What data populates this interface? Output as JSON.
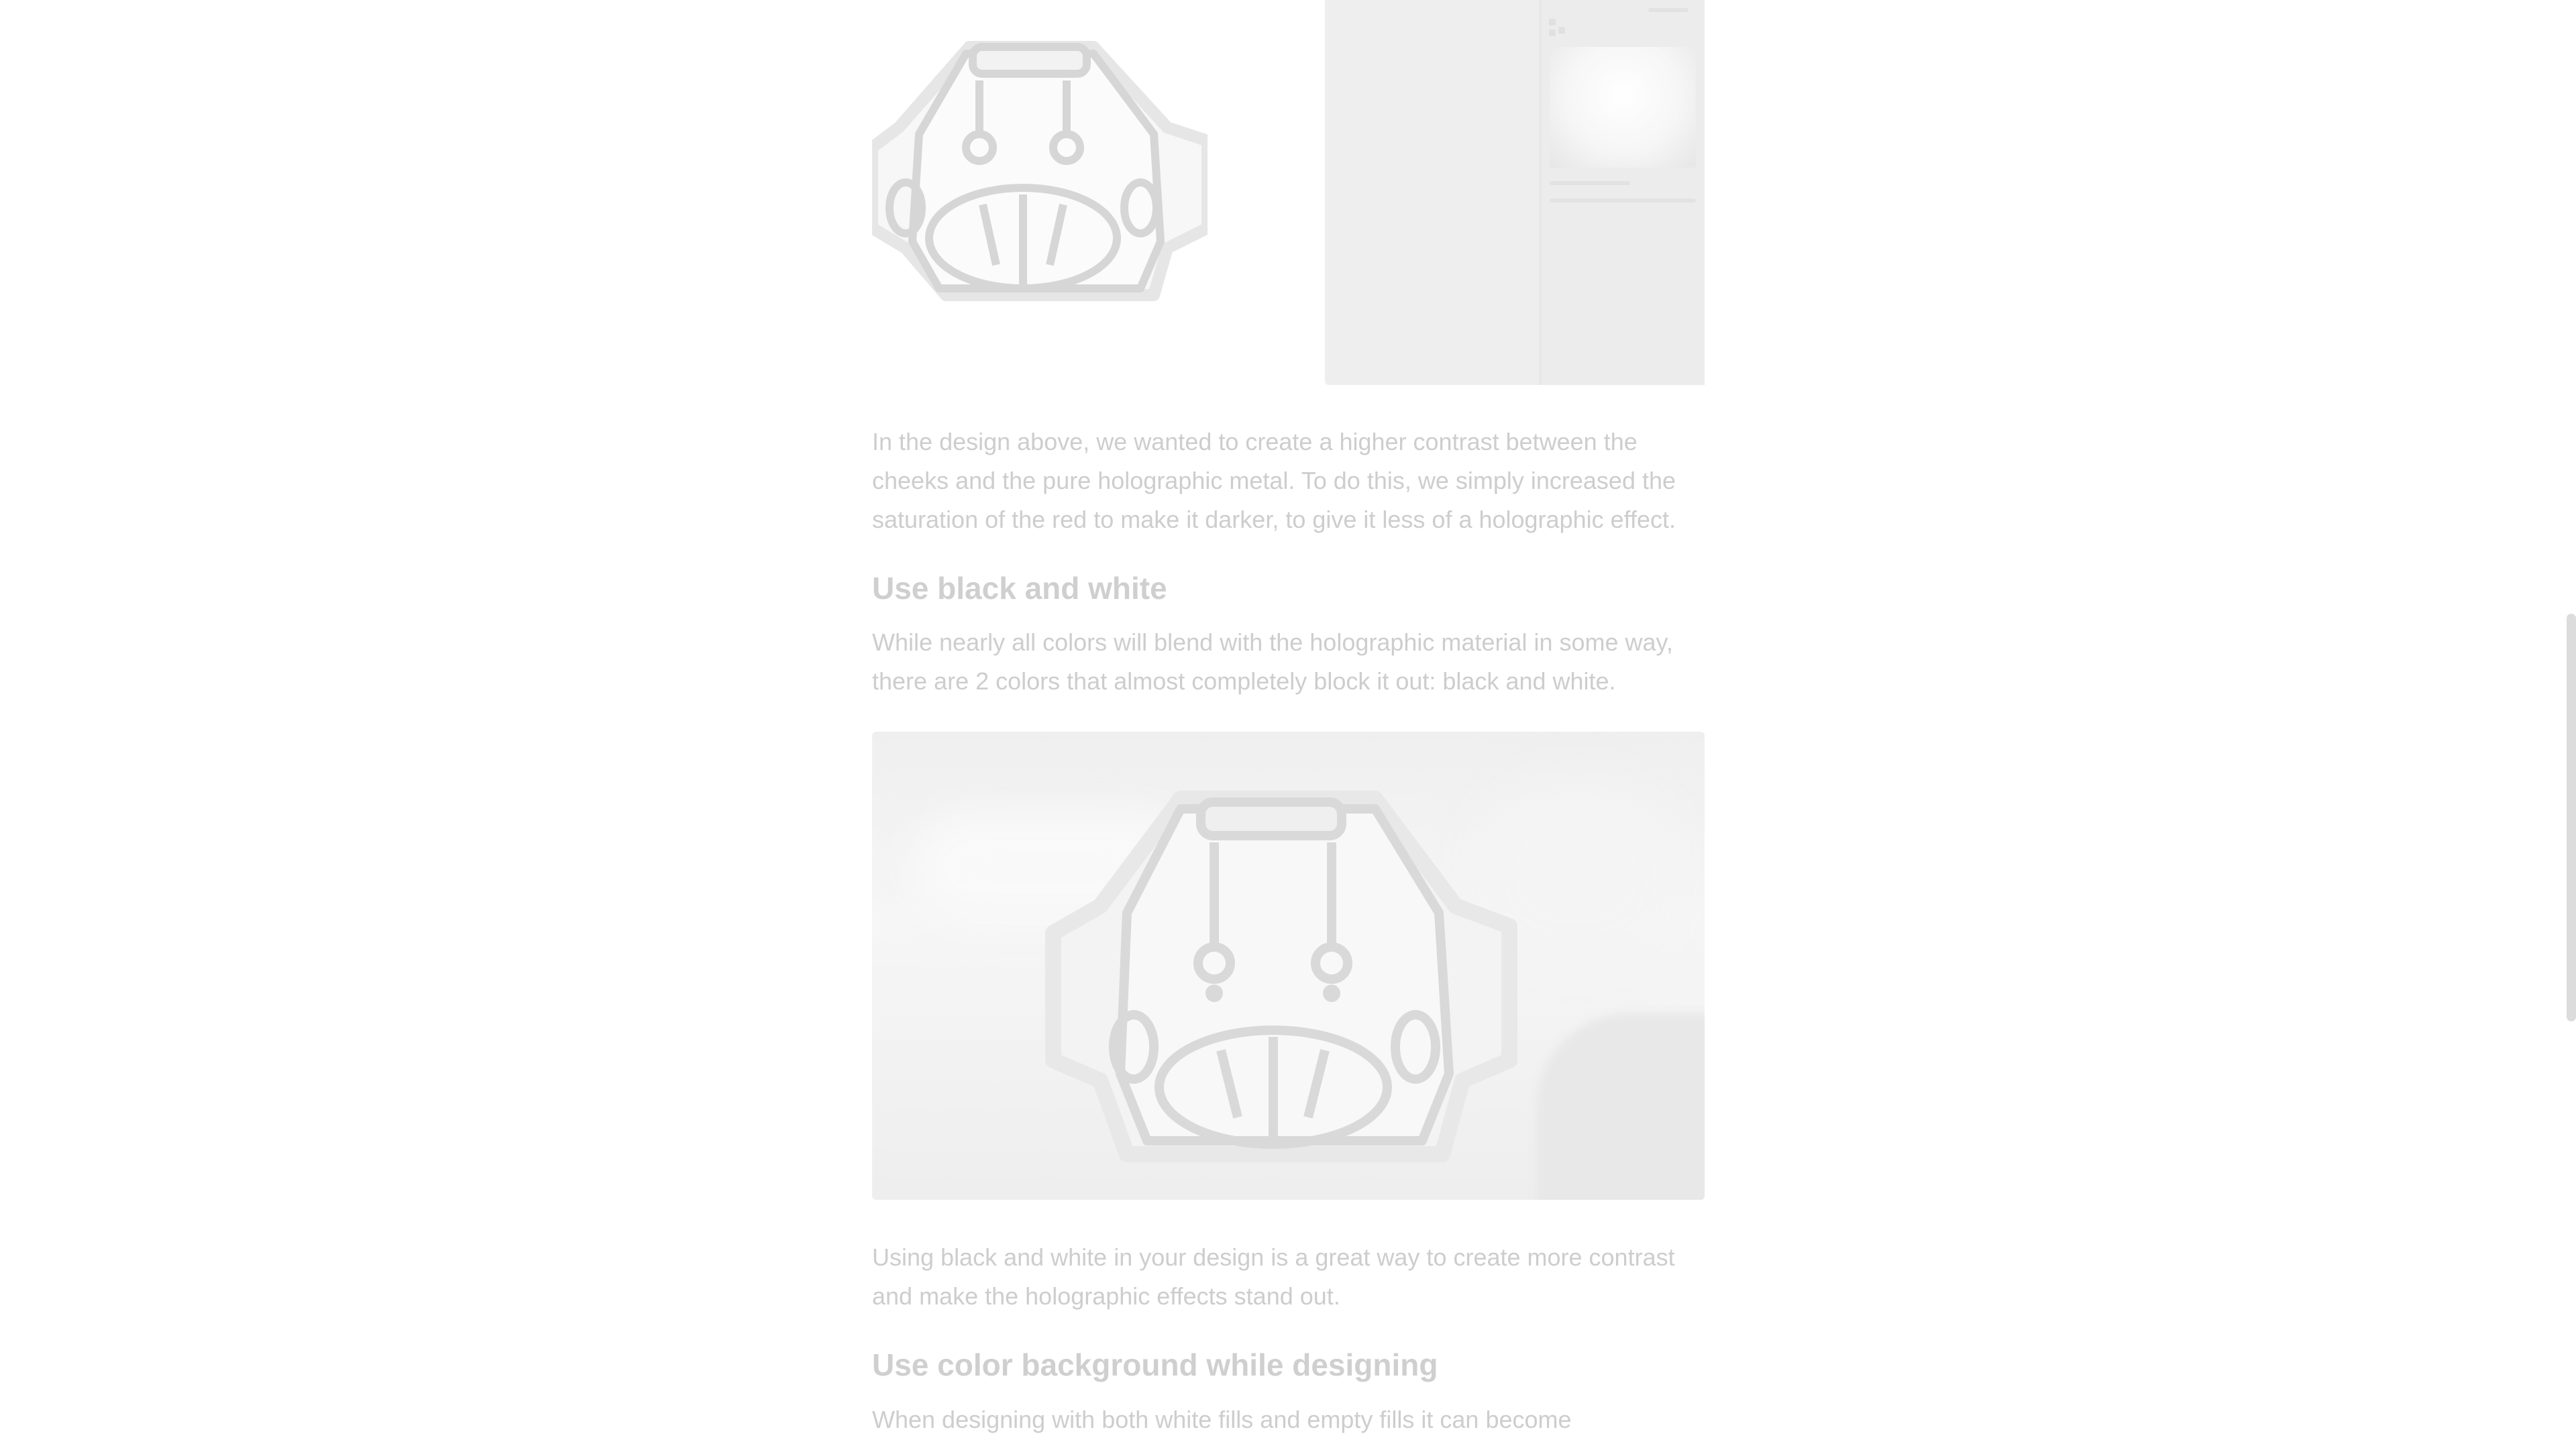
{
  "article": {
    "paragraph_contrast": "In the design above, we wanted to create a higher contrast between the cheeks and the pure holographic metal. To do this, we simply increased the saturation of the red to make it darker, to give it less of a holographic effect.",
    "heading_black_white": "Use black and white",
    "paragraph_black_white": "While nearly all colors will blend with the holographic material in some way, there are 2 colors that almost completely block it out: black and white.",
    "paragraph_using_black_white": "Using black and white in your design is a great way to create more contrast and make the holographic effects stand out.",
    "heading_color_background": "Use color background while designing",
    "paragraph_designing_fills": "When designing with both white fills and empty fills it can become"
  },
  "colors": {
    "text": "#cdcdcd",
    "heading": "#cfcfcf",
    "panel": "#eeeeee",
    "background": "#ffffff"
  },
  "icons": {
    "robot_sticker": "robot-sticker-illustration",
    "app_panel": "design-app-screenshot",
    "photo": "holographic-sticker-photo"
  }
}
